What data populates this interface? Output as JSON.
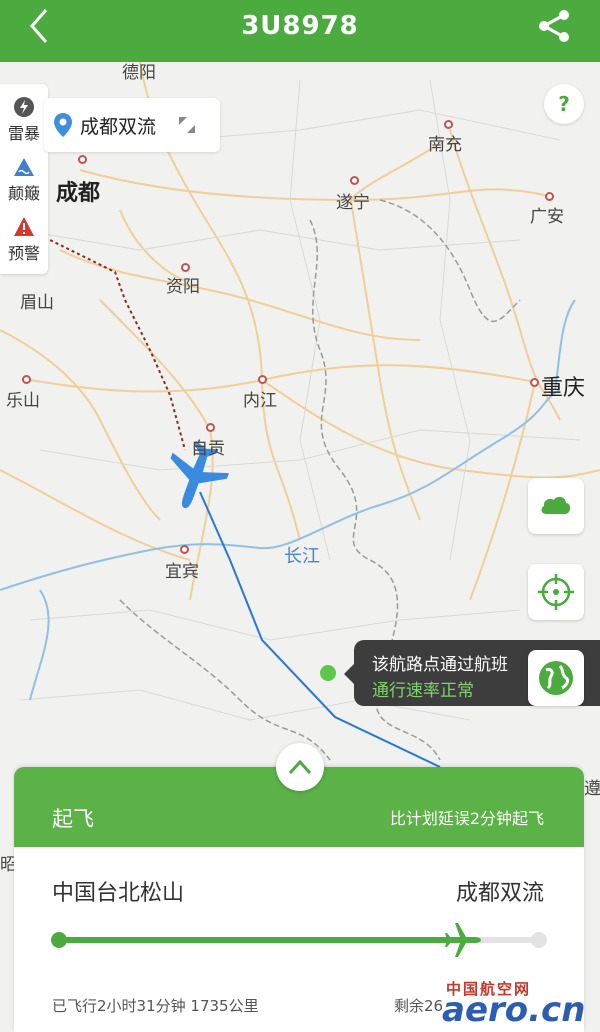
{
  "header": {
    "title": "3U8978",
    "back_icon": "chevron-left-icon",
    "share_icon": "share-icon"
  },
  "map": {
    "cities": {
      "deyang": "德阳",
      "chengdu": "成都",
      "nanchong": "南充",
      "suining": "遂宁",
      "guangan": "广安",
      "ziyang": "资阳",
      "meishan": "眉山",
      "chongqing": "重庆",
      "leshan": "乐山",
      "neijiang": "内江",
      "zigong": "自贡",
      "yibin": "宜宾"
    },
    "river": "长江",
    "edge_labels": {
      "zun": "遵",
      "zhao": "昭"
    }
  },
  "weather_panel": {
    "thunder": "雷暴",
    "turbulence": "颠簸",
    "warning": "预警"
  },
  "airport_chip": {
    "label": "成都双流"
  },
  "help_label": "?",
  "tooltip": {
    "line1": "该航路点通过航班",
    "line2": "通行速率正常"
  },
  "card": {
    "status": "起飞",
    "delay": "比计划延误2分钟起飞",
    "departure": "中国台北松山",
    "arrival": "成都双流",
    "progress": 0.84,
    "elapsed": "已飞行2小时31分钟 1735公里",
    "remaining": "剩余26"
  },
  "watermark": {
    "cn": "中国航空网",
    "en": "aero.cn"
  },
  "colors": {
    "brand": "#4bab3f",
    "route_flown": "#8b2a1e",
    "route_planned": "#2a78d6"
  }
}
